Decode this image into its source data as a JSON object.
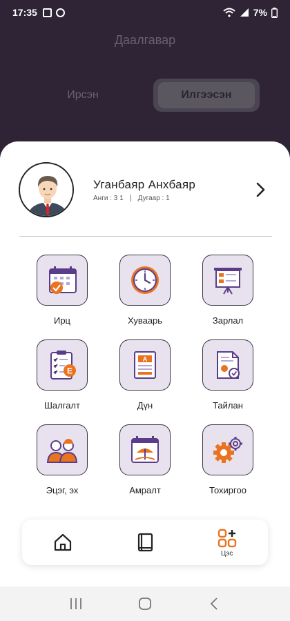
{
  "status_bar": {
    "time": "17:35",
    "battery": "7%"
  },
  "background": {
    "title": "Даалгавар",
    "tabs": [
      "Ирсэн",
      "Илгээсэн"
    ]
  },
  "profile": {
    "name": "Уганбаяр Анхбаяр",
    "class_info": "Анги : 3 1",
    "number_info": "Дугаар : 1"
  },
  "menu": [
    {
      "label": "Ирц",
      "icon": "calendar-attendance-icon"
    },
    {
      "label": "Хуваарь",
      "icon": "clock-icon"
    },
    {
      "label": "Зарлал",
      "icon": "presentation-board-icon"
    },
    {
      "label": "Шалгалт",
      "icon": "clipboard-exam-icon"
    },
    {
      "label": "Дүн",
      "icon": "grade-document-icon"
    },
    {
      "label": "Тайлан",
      "icon": "report-document-icon"
    },
    {
      "label": "Эцэг, эх",
      "icon": "parents-icon"
    },
    {
      "label": "Амралт",
      "icon": "vacation-calendar-icon"
    },
    {
      "label": "Тохиргоо",
      "icon": "settings-gears-icon"
    }
  ],
  "bottom_nav": {
    "menu_label": "Цэс"
  },
  "colors": {
    "accent": "#e9731f",
    "purple": "#5a3d8a",
    "tile_bg": "#e8e2ee",
    "dark_bg": "#2e2436"
  }
}
